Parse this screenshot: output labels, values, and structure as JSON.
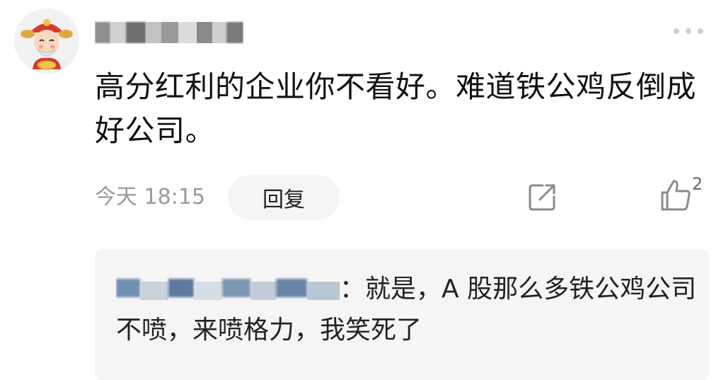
{
  "comment": {
    "text": "高分红利的企业你不看好。难道铁公鸡反倒成好公司。",
    "timestamp": "今天 18:15",
    "reply_label": "回复",
    "like_count": "2"
  },
  "reply": {
    "text": "：就是，A 股那么多铁公鸡公司不喷，来喷格力，我笑死了"
  },
  "icons": {
    "avatar": "god-of-wealth-avatar",
    "more": "more-icon",
    "share": "share-icon",
    "like": "thumbs-up-icon"
  },
  "colors": {
    "reply_background": "#f5f5f5",
    "muted_text": "#9a9a9a",
    "icon_gray": "#8a8a8a"
  }
}
